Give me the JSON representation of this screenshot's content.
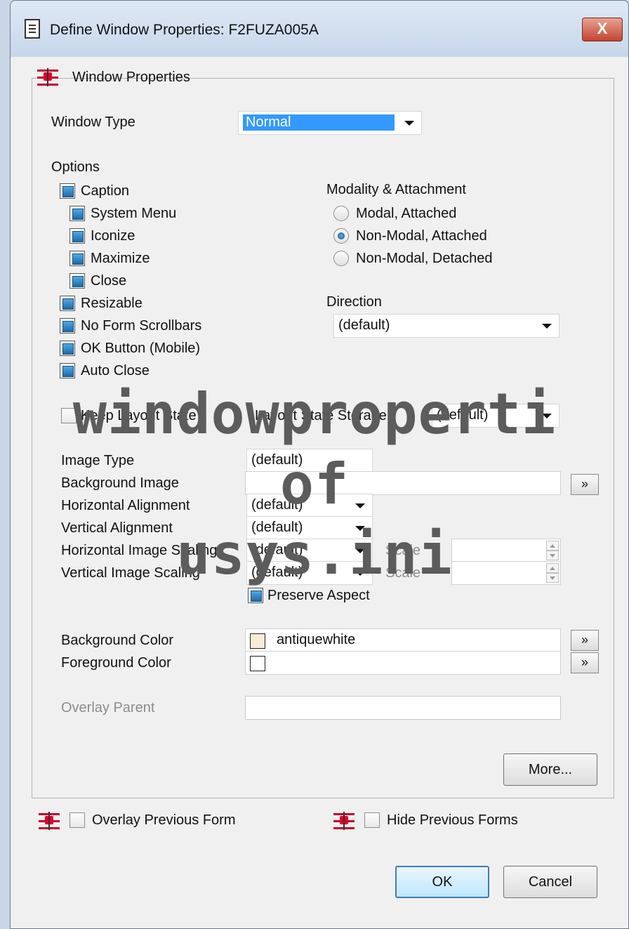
{
  "window": {
    "title": "Define Window Properties: F2FUZA005A",
    "close_glyph": "X"
  },
  "group": {
    "legend": "Window Properties"
  },
  "window_type": {
    "label": "Window Type",
    "value": "Normal"
  },
  "options": {
    "label": "Options",
    "items": [
      {
        "label": "Caption",
        "checked": true
      },
      {
        "label": "System Menu",
        "checked": true
      },
      {
        "label": "Iconize",
        "checked": true
      },
      {
        "label": "Maximize",
        "checked": true
      },
      {
        "label": "Close",
        "checked": true
      },
      {
        "label": "Resizable",
        "checked": true
      },
      {
        "label": "No Form Scrollbars",
        "checked": true
      },
      {
        "label": "OK Button (Mobile)",
        "checked": true
      },
      {
        "label": "Auto Close",
        "checked": true
      }
    ]
  },
  "modality": {
    "label": "Modality & Attachment",
    "options": [
      "Modal, Attached",
      "Non-Modal, Attached",
      "Non-Modal, Detached"
    ],
    "selected": "Non-Modal, Attached"
  },
  "direction": {
    "label": "Direction",
    "value": "(default)"
  },
  "layout": {
    "keep_label": "Keep Layout State",
    "storage_label": "Layout State Storage",
    "storage_value": "(default)"
  },
  "image": {
    "type_label": "Image Type",
    "type_value": "(default)",
    "background_label": "Background Image",
    "background_value": "",
    "browse_glyph": "»",
    "h_align_label": "Horizontal Alignment",
    "h_align_value": "(default)",
    "v_align_label": "Vertical Alignment",
    "v_align_value": "(default)",
    "h_scaling_label": "Horizontal Image Scaling",
    "h_scaling_value": "(default)",
    "v_scaling_label": "Vertical Image Scaling",
    "v_scaling_value": "(default)",
    "scale_label": "Scale",
    "preserve_label": "Preserve Aspect"
  },
  "colors": {
    "background_label": "Background Color",
    "background_value": "antiquewhite",
    "background_swatch": "#faebd7",
    "foreground_label": "Foreground Color",
    "foreground_value": "",
    "foreground_swatch": "#ffffff",
    "browse_glyph": "»"
  },
  "overlay_parent": {
    "label": "Overlay Parent",
    "value": ""
  },
  "buttons": {
    "more": "More...",
    "ok": "OK",
    "cancel": "Cancel"
  },
  "footer": {
    "overlay_previous": "Overlay Previous Form",
    "hide_previous": "Hide Previous Forms"
  },
  "watermark": {
    "line1": "windowproperti",
    "line2": "of",
    "line3": "usys.ini"
  }
}
